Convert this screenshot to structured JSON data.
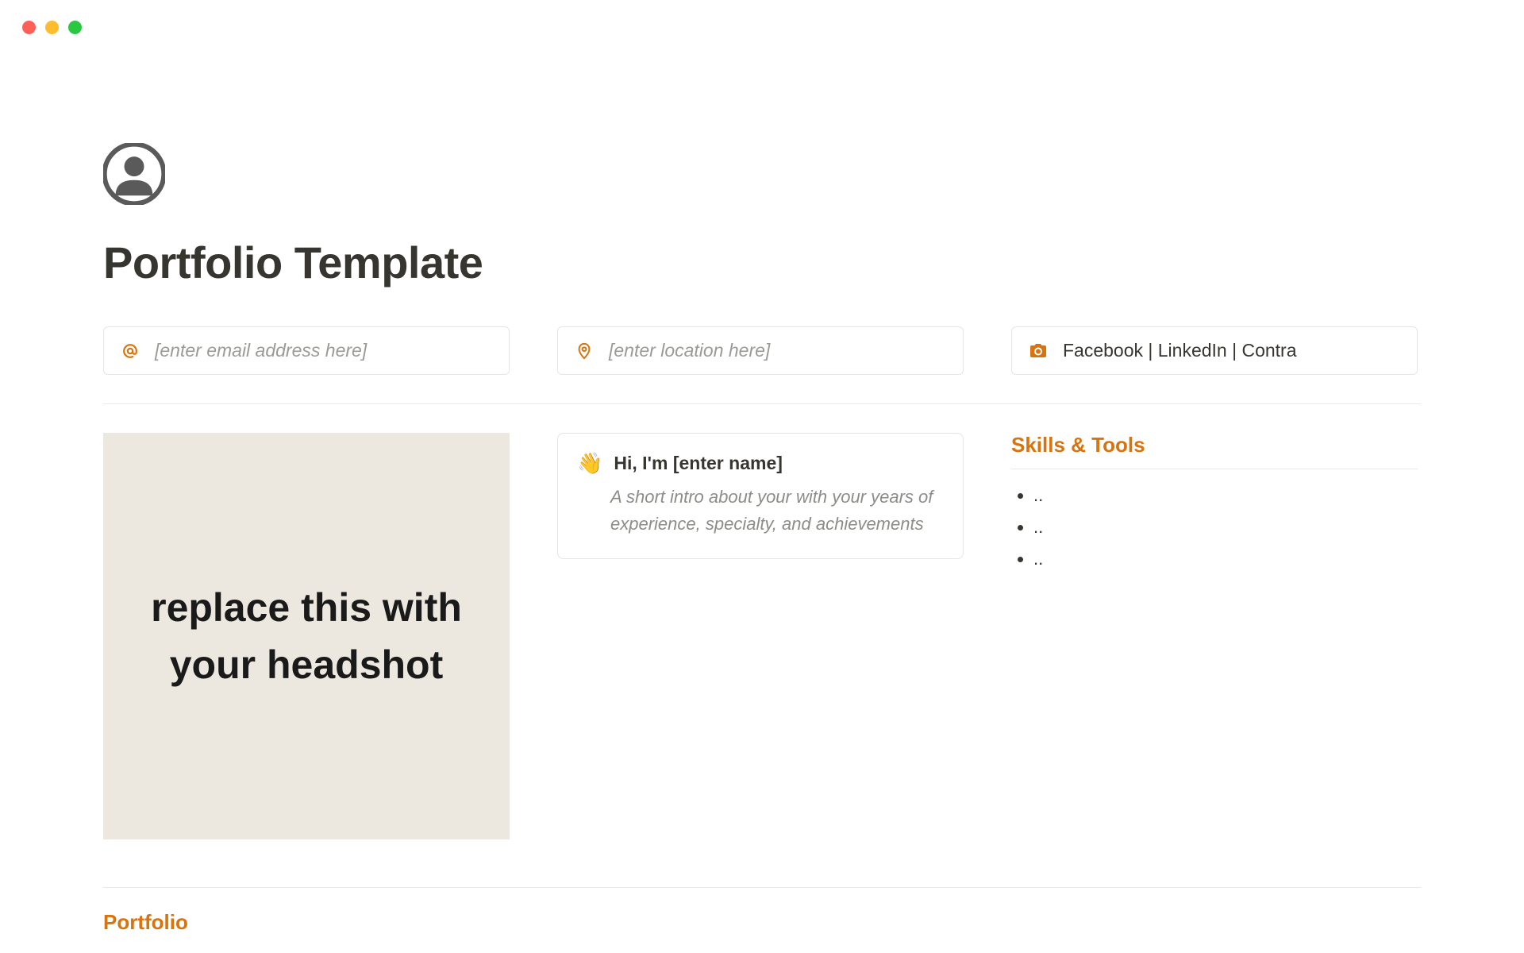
{
  "colors": {
    "accent": "#d9730d",
    "text": "#37352f",
    "muted": "#9b9a97",
    "border": "#e5e5e3",
    "headshot_bg": "#ece8df"
  },
  "avatar_icon": "person-circle-icon",
  "title": "Portfolio Template",
  "info_cards": {
    "email": {
      "icon": "at-icon",
      "placeholder": "[enter email address here]"
    },
    "location": {
      "icon": "location-pin-icon",
      "placeholder": "[enter location here]"
    },
    "social": {
      "icon": "camera-icon",
      "text": "Facebook | LinkedIn | Contra"
    }
  },
  "headshot_placeholder": "replace this with your headshot",
  "intro": {
    "emoji": "👋",
    "heading": "Hi, I'm [enter name]",
    "body": "A short intro about your with your years of experience, specialty, and achievements"
  },
  "skills": {
    "heading": "Skills & Tools",
    "items": [
      "..",
      "..",
      ".."
    ]
  },
  "portfolio_heading": "Portfolio"
}
